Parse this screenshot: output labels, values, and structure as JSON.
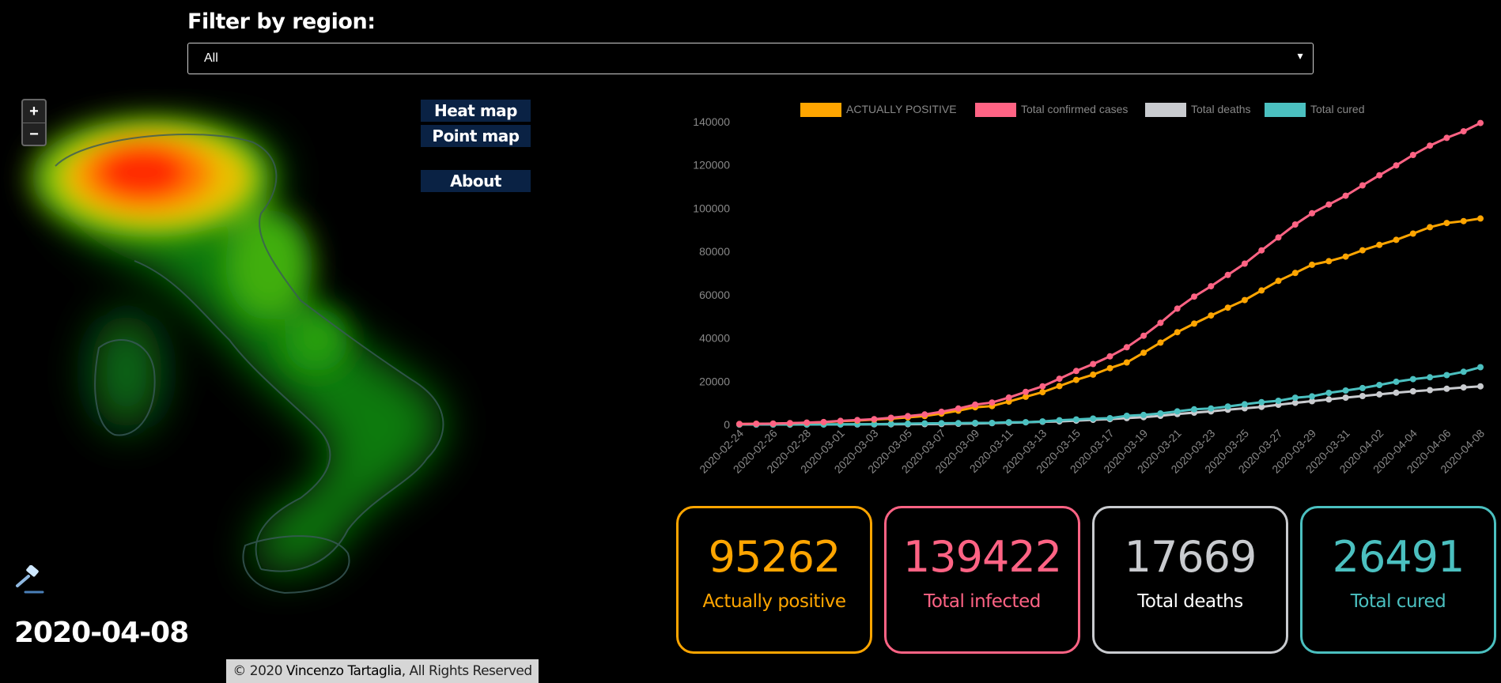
{
  "filter": {
    "label": "Filter by region:",
    "selected": "All"
  },
  "map": {
    "zoom_in": "+",
    "zoom_out": "−",
    "buttons": {
      "heat": "Heat map",
      "point": "Point map",
      "about": "About"
    },
    "date": "2020-04-08",
    "icon": "gavel-icon"
  },
  "footer": {
    "prefix": "© 2020 ",
    "author": "Vincenzo Tartaglia",
    "suffix": ", All Rights Reserved"
  },
  "colors": {
    "positive": "#FFA500",
    "confirmed": "#FF6384",
    "deaths": "#C9CBCF",
    "cured": "#4BC0C0"
  },
  "chart_data": {
    "type": "line",
    "legend_placement": "top",
    "ylim": [
      0,
      140000
    ],
    "y_ticks": [
      "0",
      "20000",
      "40000",
      "60000",
      "80000",
      "100000",
      "120000",
      "140000"
    ],
    "x_tick_labels": [
      "2020-02-24",
      "2020-02-26",
      "2020-02-28",
      "2020-03-01",
      "2020-03-03",
      "2020-03-05",
      "2020-03-07",
      "2020-03-09",
      "2020-03-11",
      "2020-03-13",
      "2020-03-15",
      "2020-03-17",
      "2020-03-19",
      "2020-03-21",
      "2020-03-23",
      "2020-03-25",
      "2020-03-27",
      "2020-03-29",
      "2020-03-31",
      "2020-04-02",
      "2020-04-04",
      "2020-04-06",
      "2020-04-08"
    ],
    "x_count": 45,
    "series": [
      {
        "name": "ACTUALLY POSITIVE",
        "color": "#FFA500",
        "values": [
          221,
          311,
          385,
          588,
          821,
          1049,
          1577,
          1835,
          2263,
          2706,
          3296,
          3916,
          5061,
          6387,
          7985,
          8514,
          10590,
          12839,
          14955,
          17750,
          20603,
          23073,
          26062,
          28710,
          33190,
          37860,
          42681,
          46638,
          50418,
          54030,
          57521,
          62013,
          66414,
          70065,
          73880,
          75528,
          77635,
          80572,
          83049,
          85388,
          88274,
          91246,
          93187,
          94067,
          95262
        ]
      },
      {
        "name": "Total confirmed cases",
        "color": "#FF6384",
        "values": [
          229,
          322,
          400,
          650,
          888,
          1128,
          1694,
          2036,
          2502,
          3089,
          3858,
          4636,
          5883,
          7375,
          9172,
          10149,
          12462,
          15113,
          17660,
          21157,
          24747,
          27980,
          31506,
          35713,
          41035,
          47021,
          53578,
          59138,
          63927,
          69176,
          74386,
          80539,
          86498,
          92472,
          97689,
          101739,
          105792,
          110574,
          115242,
          119827,
          124632,
          128948,
          132547,
          135586,
          139422
        ]
      },
      {
        "name": "Total deaths",
        "color": "#C9CBCF",
        "values": [
          7,
          10,
          12,
          17,
          21,
          29,
          34,
          52,
          79,
          107,
          148,
          197,
          233,
          366,
          463,
          631,
          827,
          1016,
          1266,
          1441,
          1809,
          2158,
          2503,
          2978,
          3405,
          4032,
          4825,
          5476,
          6077,
          6820,
          7503,
          8165,
          9134,
          10023,
          10779,
          11591,
          12428,
          13155,
          13915,
          14681,
          15362,
          15887,
          16523,
          17127,
          17669
        ]
      },
      {
        "name": "Total cured",
        "color": "#4BC0C0",
        "values": [
          1,
          1,
          3,
          45,
          46,
          46,
          83,
          149,
          160,
          276,
          414,
          523,
          589,
          622,
          724,
          724,
          1045,
          1045,
          1439,
          1966,
          2335,
          2749,
          2941,
          4025,
          4440,
          5129,
          6072,
          7024,
          7432,
          8326,
          9362,
          10361,
          10950,
          12384,
          13030,
          14620,
          15729,
          16847,
          18278,
          19758,
          20996,
          21815,
          22837,
          24392,
          26491
        ]
      }
    ]
  },
  "stats": [
    {
      "value": "95262",
      "label": "Actually positive",
      "color": "#FFA500"
    },
    {
      "value": "139422",
      "label": "Total infected",
      "color": "#FF6384"
    },
    {
      "value": "17669",
      "label": "Total deaths",
      "color": "#C9CBCF"
    },
    {
      "value": "26491",
      "label": "Total cured",
      "color": "#4BC0C0"
    }
  ]
}
